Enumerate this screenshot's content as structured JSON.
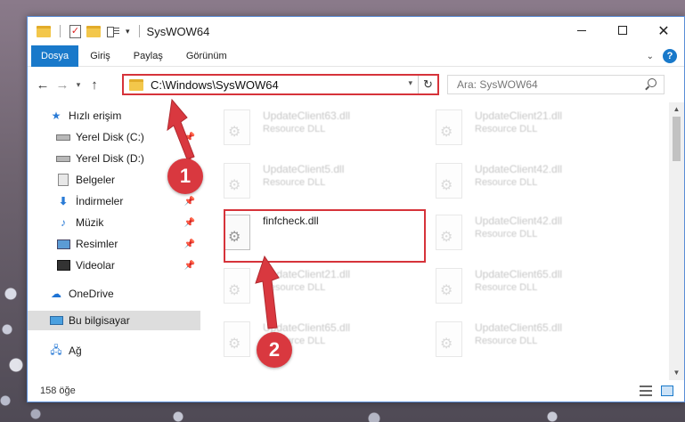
{
  "window": {
    "title": "SysWOW64"
  },
  "ribbon": {
    "tabs": [
      "Dosya",
      "Giriş",
      "Paylaş",
      "Görünüm"
    ],
    "help": "?"
  },
  "address": {
    "path": "C:\\Windows\\SysWOW64",
    "search_placeholder": "Ara: SysWOW64"
  },
  "sidebar": {
    "quick_access": "Hızlı erişim",
    "items": [
      {
        "label": "Yerel Disk (C:)",
        "icon": "drive-icon",
        "pinned": true
      },
      {
        "label": "Yerel Disk (D:)",
        "icon": "drive-icon",
        "pinned": true
      },
      {
        "label": "Belgeler",
        "icon": "documents-icon",
        "pinned": true
      },
      {
        "label": "İndirmeler",
        "icon": "download-icon",
        "pinned": true
      },
      {
        "label": "Müzik",
        "icon": "music-icon",
        "pinned": true
      },
      {
        "label": "Resimler",
        "icon": "pictures-icon",
        "pinned": true
      },
      {
        "label": "Videolar",
        "icon": "videos-icon",
        "pinned": true
      }
    ],
    "onedrive": "OneDrive",
    "this_pc": "Bu bilgisayar",
    "network": "Ağ"
  },
  "files": [
    {
      "name": "UpdateClient63.dll",
      "type": "Resource DLL",
      "faded": true
    },
    {
      "name": "UpdateClient21.dll",
      "type": "Resource DLL",
      "faded": true
    },
    {
      "name": "UpdateClient5.dll",
      "type": "Resource DLL",
      "faded": true
    },
    {
      "name": "UpdateClient42.dll",
      "type": "Resource DLL",
      "faded": true
    },
    {
      "name": "finfcheck.dll",
      "type": "",
      "faded": false,
      "highlighted": true
    },
    {
      "name": "UpdateClient42.dll",
      "type": "Resource DLL",
      "faded": true
    },
    {
      "name": "UpdateClient21.dll",
      "type": "Resource DLL",
      "faded": true
    },
    {
      "name": "UpdateClient65.dll",
      "type": "Resource DLL",
      "faded": true
    },
    {
      "name": "UpdateClient65.dll",
      "type": "Resource DLL",
      "faded": true
    },
    {
      "name": "UpdateClient65.dll",
      "type": "Resource DLL",
      "faded": true
    }
  ],
  "status": {
    "count": "158 öğe"
  },
  "annotations": {
    "step1": "1",
    "step2": "2",
    "color": "#d6333a"
  }
}
